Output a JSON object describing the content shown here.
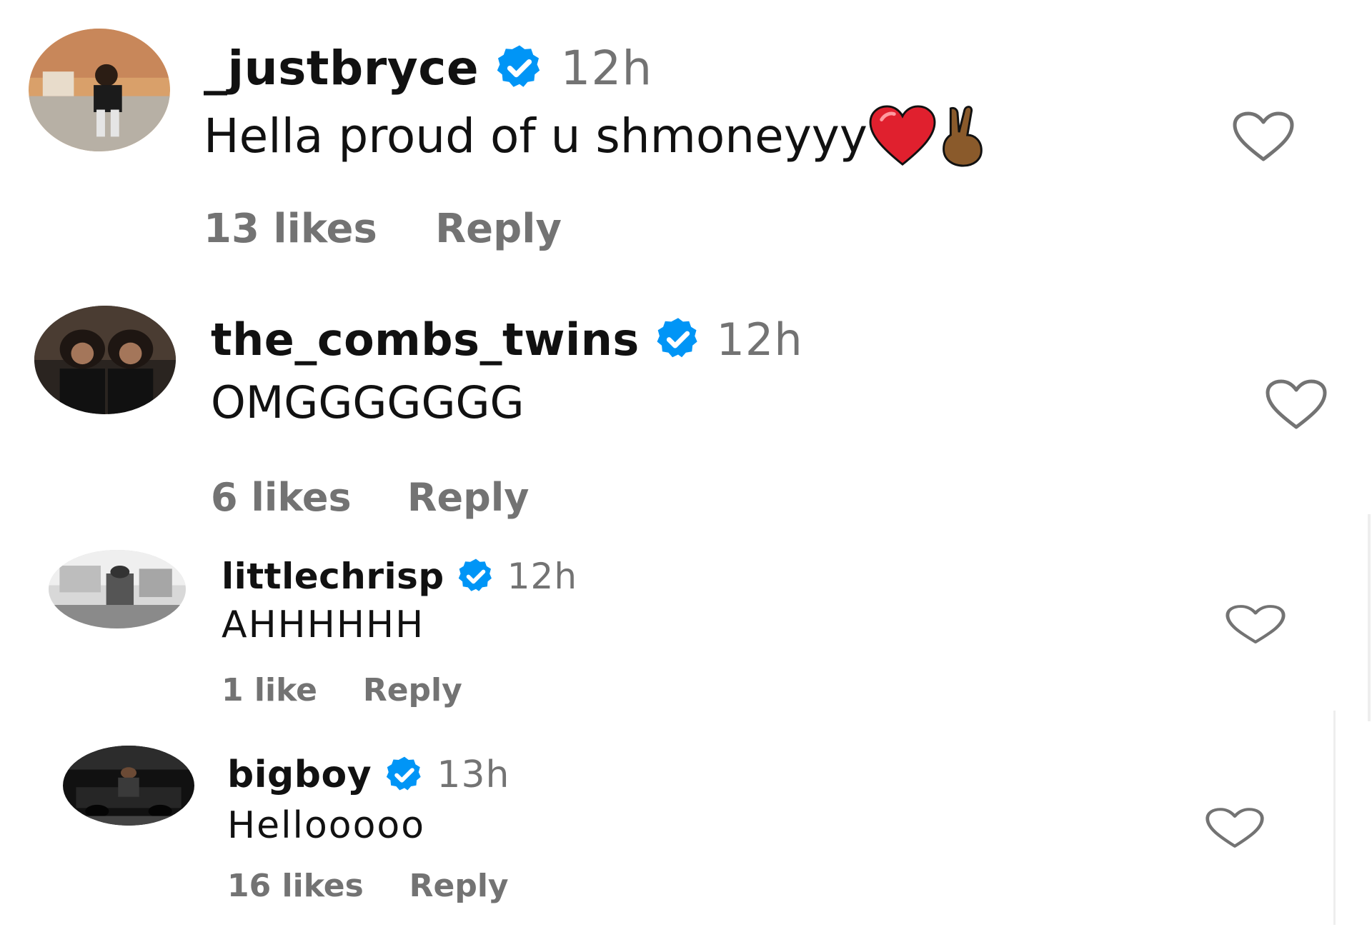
{
  "comments": [
    {
      "username": "_justbryce",
      "verified": true,
      "time": "12h",
      "text": "Hella proud of u shmoneyyy",
      "emojis": [
        "red-heart-emoji",
        "crossed-fingers-emoji"
      ],
      "likes": "13 likes",
      "reply": "Reply"
    },
    {
      "username": "the_combs_twins",
      "verified": true,
      "time": "12h",
      "text": "OMGGGGGGG",
      "likes": "6 likes",
      "reply": "Reply"
    },
    {
      "username": "littlechrisp",
      "verified": true,
      "time": "12h",
      "text": "AHHHHHH",
      "likes": "1 like",
      "reply": "Reply"
    },
    {
      "username": "bigboy",
      "verified": true,
      "time": "13h",
      "text": "Hellooooo",
      "likes": "16 likes",
      "reply": "Reply"
    }
  ],
  "colors": {
    "verified_blue": "#0095f6",
    "secondary_text": "#737373",
    "primary_text": "#111111",
    "heart_red": "#e0202e"
  },
  "icons": {
    "verified": "verified-badge-icon",
    "like": "heart-outline-icon"
  }
}
